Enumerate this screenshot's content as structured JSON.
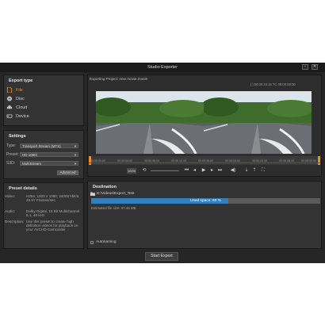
{
  "window": {
    "title": "Studio Exporter"
  },
  "export_type": {
    "title": "Export type",
    "items": [
      {
        "label": "File",
        "icon": "file-icon",
        "active": true
      },
      {
        "label": "Disc",
        "icon": "disc-icon",
        "active": false
      },
      {
        "label": "Cloud",
        "icon": "cloud-icon",
        "active": false
      },
      {
        "label": "Device",
        "icon": "device-icon",
        "active": false
      }
    ]
  },
  "settings": {
    "title": "Settings",
    "type": {
      "label": "Type:",
      "value": "Transport Stream (MTS)"
    },
    "preset": {
      "label": "Preset:",
      "value": "HD 1080i"
    },
    "s3d": {
      "label": "S3D:",
      "value": "MultiStream"
    },
    "advanced_label": "Advanced"
  },
  "preset_details": {
    "title": "Preset details",
    "video": {
      "label": "Video:",
      "value": "H264, 1920 x 1080, 24000 kbit/s, 29.97 Frames/sec"
    },
    "audio": {
      "label": "Audio:",
      "value": "Dolby Digital, 16 Bit Multichannel 5.1, 48 kHz"
    },
    "description": {
      "label": "Description:",
      "value": "Use this preset to create high definition videos for playback on your AVCHD Camcorder"
    }
  },
  "preview": {
    "project_label": "Exporting Project: new movie.movie",
    "timecode": "[ ] 00:00:33.15   TC  00:00:00:00",
    "timeline_labels": [
      "00:00:00.00",
      "00:00:04.00",
      "00:00:08.00",
      "00:00:12.00",
      "00:00:16.00",
      "00:00:20.00",
      "00:00:24.00",
      "00:00:28.00",
      "00:00:32.00"
    ],
    "zoom_label": "100%"
  },
  "destination": {
    "title": "Destination",
    "path": "D:\\Videos\\Export_Test",
    "used_space_label": "Used space: 60 %",
    "used_space": 0.6,
    "estimated_size": "Estimated file size: 97.46 MB",
    "autonaming_label": "Autonaming"
  },
  "start_export_label": "Start Export",
  "colors": {
    "accent": "#f28a1e",
    "progress": "#2f7fbf",
    "background": "#262626",
    "panel": "#333333"
  }
}
